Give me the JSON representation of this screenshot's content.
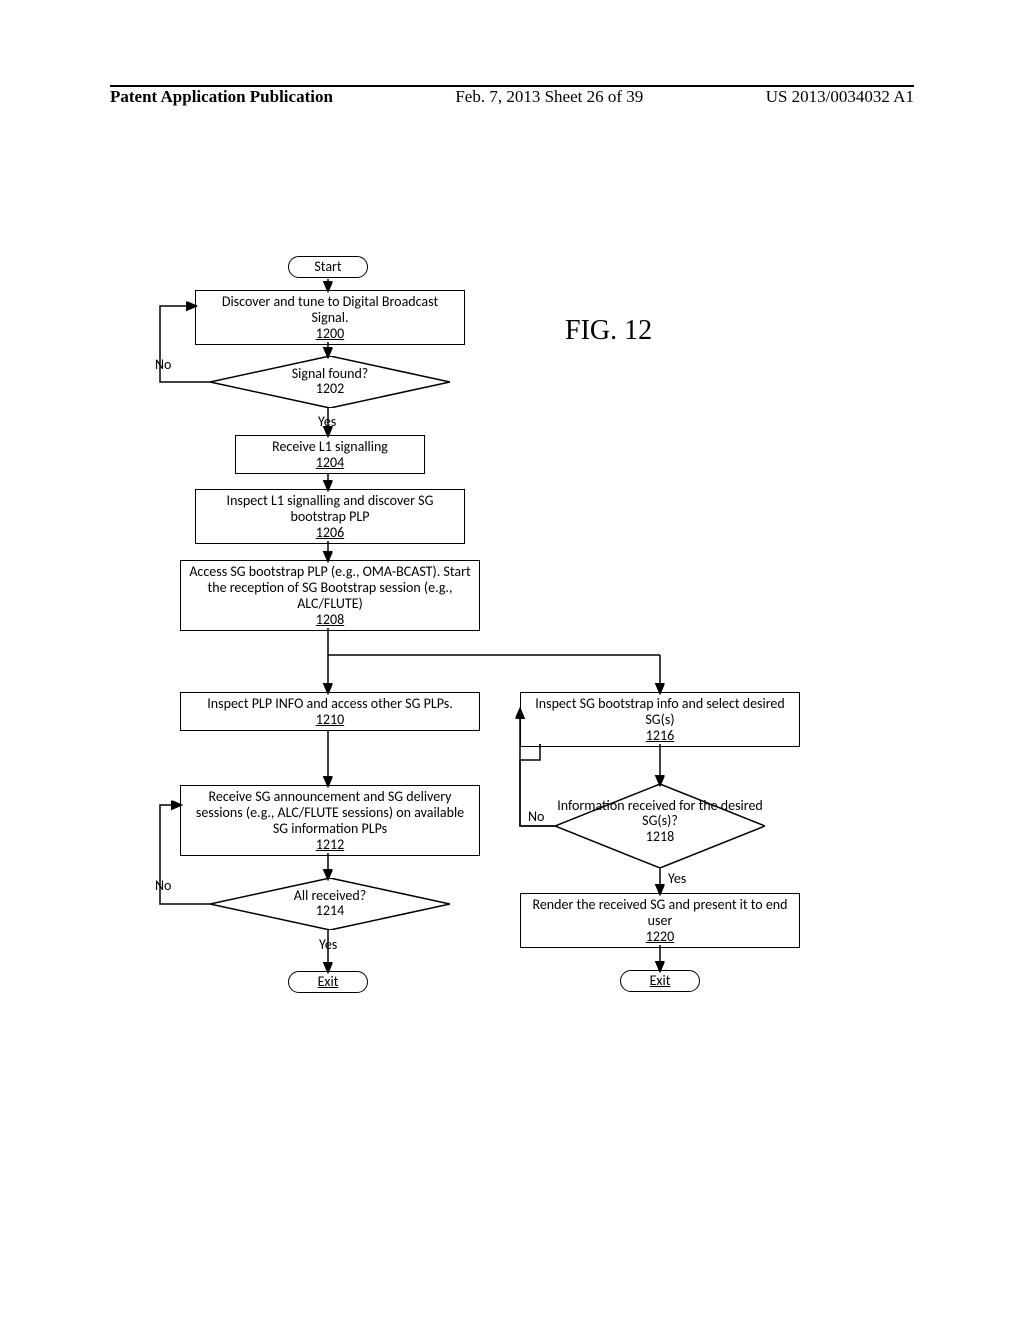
{
  "header": {
    "left": "Patent Application Publication",
    "center": "Feb. 7, 2013  Sheet 26 of 39",
    "right": "US 2013/0034032 A1"
  },
  "figure_label": "FIG. 12",
  "nodes": {
    "start": "Start",
    "n1200": {
      "text": "Discover and tune to Digital Broadcast Signal.",
      "ref": "1200"
    },
    "d1202": {
      "text": "Signal found?",
      "ref": "1202"
    },
    "n1204": {
      "text": "Receive L1 signalling",
      "ref": "1204"
    },
    "n1206": {
      "text": "Inspect L1 signalling and discover SG bootstrap PLP",
      "ref": "1206"
    },
    "n1208": {
      "text": "Access SG bootstrap PLP (e.g., OMA-BCAST). Start the reception of SG Bootstrap session (e.g., ALC/FLUTE)",
      "ref": "1208"
    },
    "n1210": {
      "text": "Inspect PLP INFO and access other SG PLPs.",
      "ref": "1210"
    },
    "n1212": {
      "text": "Receive SG announcement and SG delivery sessions (e.g., ALC/FLUTE sessions) on available SG information PLPs",
      "ref": "1212"
    },
    "d1214": {
      "text": "All received?",
      "ref": "1214"
    },
    "exit_left": "Exit",
    "n1216": {
      "text": "Inspect SG bootstrap info and select desired SG(s)",
      "ref": "1216"
    },
    "d1218": {
      "text": "Information received  for the desired SG(s)?",
      "ref": "1218"
    },
    "n1220": {
      "text": "Render the received SG and present it to end user",
      "ref": "1220"
    },
    "exit_right": "Exit"
  },
  "labels": {
    "no": "No",
    "yes": "Yes"
  }
}
